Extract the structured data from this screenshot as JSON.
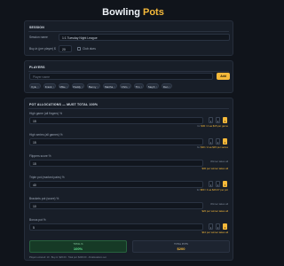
{
  "app": {
    "title_main": "Bowling",
    "title_accent": "Pots",
    "subtitle": "Set up your session and track your pots."
  },
  "session": {
    "heading": "SESSION",
    "name_label": "Session name",
    "name_value": "1:1 Tuesday Night League",
    "buyin_label": "Buy-in (per player) $",
    "buyin_value": "20",
    "checkbox_label": "Club dues"
  },
  "players": {
    "heading": "PLAYERS",
    "input_placeholder": "Player name",
    "add_label": "Add",
    "remove_symbol": "×",
    "list": [
      "Kyle",
      "Frank",
      "Mike",
      "Paddy",
      "Benny",
      "Martha",
      "Chris",
      "Tim",
      "Steph",
      "Dan"
    ]
  },
  "allocations": {
    "heading": "POT ALLOCATIONS — MUST TOTAL 100%",
    "rows": [
      {
        "label": "High game (all fingers) %",
        "value": "15",
        "places": [
          "1",
          "2",
          "3"
        ],
        "active_place": 2,
        "hint_prefix": "for",
        "hint_amount": "$30 / 2 ea $15 per game"
      },
      {
        "label": "High series (all games) %",
        "value": "15",
        "places": [
          "1",
          "2",
          "3"
        ],
        "active_place": 2,
        "hint_prefix": "for",
        "hint_amount": "$30 / 2 ea $15 per series"
      },
      {
        "label": "Flippers score %",
        "value": "15",
        "places": [],
        "active_place": null,
        "hint_top": "Winner takes all",
        "hint_prefix": "",
        "hint_amount": "$30 per winner takes all"
      },
      {
        "label": "Triple pot (marked pairs) %",
        "value": "40",
        "places": [
          "1",
          "2",
          "3"
        ],
        "active_place": 2,
        "hint_prefix": "for",
        "hint_amount": "$80 / 3 ea $26.67 per pot"
      },
      {
        "label": "Brackets pot (score) %",
        "value": "10",
        "places": [],
        "active_place": null,
        "hint_top": "Winner takes all",
        "hint_prefix": "",
        "hint_amount": "$20 per winner takes all"
      },
      {
        "label": "Bonus pot %",
        "value": "5",
        "places": [
          "1",
          "2",
          "3"
        ],
        "active_place": 2,
        "hint_prefix": "",
        "hint_amount": "$10 per winner takes all"
      }
    ],
    "total_label": "TOTAL %",
    "total_value": "100%",
    "pot_label": "TOTAL POTS",
    "pot_value": "$200",
    "footer": "Players entered: 10 · Buy-in: $20.00 · Total pot: $200.00 · All allocations set"
  },
  "colors": {
    "accent": "#f5b93a",
    "total_ok": "#3fbf6b",
    "background": "#10141b",
    "card": "#181e28"
  }
}
